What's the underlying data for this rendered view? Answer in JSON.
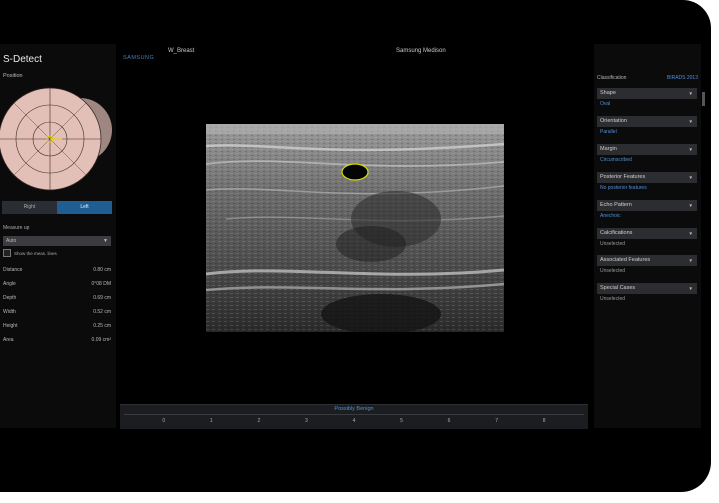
{
  "left_panel": {
    "title": "S-Detect",
    "position_label": "Position",
    "tabs": [
      {
        "label": "Right",
        "active": false
      },
      {
        "label": "Left",
        "active": true
      }
    ],
    "measure_label": "Measure up",
    "measure_value": "Auto",
    "show_max_lines": "Show the meas. lines",
    "measurements": [
      {
        "label": "Distance",
        "value": "0.80 cm"
      },
      {
        "label": "Angle",
        "value": "0°08 DM"
      },
      {
        "label": "Depth",
        "value": "0.69 cm"
      },
      {
        "label": "Width",
        "value": "0.52 cm"
      },
      {
        "label": "Height",
        "value": "0.25 cm"
      },
      {
        "label": "Area",
        "value": "0.09 cm²"
      }
    ]
  },
  "center": {
    "brand": "SAMSUNG",
    "preset": "W_Breast",
    "hospital": "Samsung Medison",
    "bottom_title": "Possibly Benign",
    "bottom_scale": [
      "0",
      "1",
      "2",
      "3",
      "4",
      "5",
      "6",
      "7",
      "8"
    ]
  },
  "right_panel": {
    "header_title": "Classification",
    "header_link": "BIRADS 2013",
    "categories": [
      {
        "name": "Shape",
        "value": "Oval",
        "muted": false
      },
      {
        "name": "Orientation",
        "value": "Parallel",
        "muted": false
      },
      {
        "name": "Margin",
        "value": "Circumscribed",
        "muted": false
      },
      {
        "name": "Posterior Features",
        "value": "No posterior features",
        "muted": false
      },
      {
        "name": "Echo Pattern",
        "value": "Anechoic",
        "muted": false
      },
      {
        "name": "Calcifications",
        "value": "Unselected",
        "muted": true
      },
      {
        "name": "Associated Features",
        "value": "Unselected",
        "muted": true
      },
      {
        "name": "Special Cases",
        "value": "Unselected",
        "muted": true
      }
    ]
  },
  "colors": {
    "accent": "#4f8fd3",
    "active_tab": "#1f5e93",
    "lesion_outline": "#d8e000"
  }
}
